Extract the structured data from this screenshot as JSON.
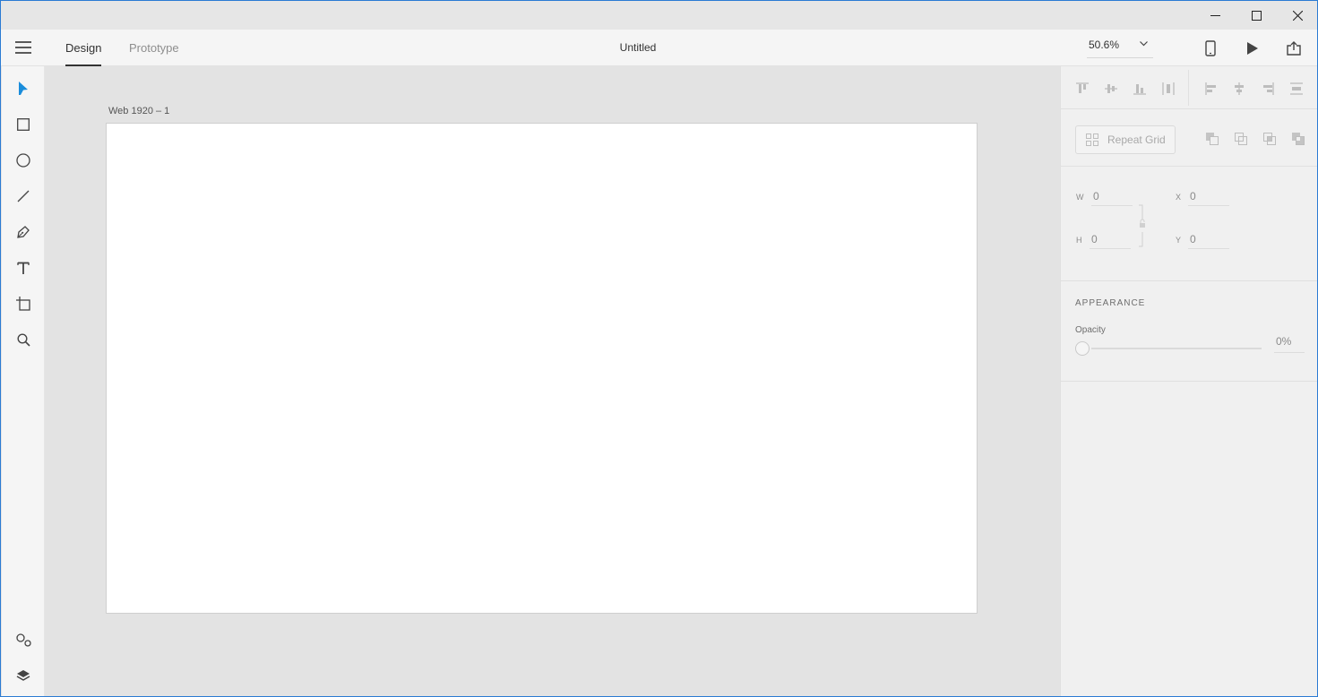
{
  "app": {
    "document_title": "Untitled",
    "tabs": [
      {
        "label": "Design",
        "active": true
      },
      {
        "label": "Prototype",
        "active": false
      }
    ],
    "zoom": "50.6%"
  },
  "window_controls": [
    "minimize-icon",
    "maximize-icon",
    "close-icon"
  ],
  "toolbar": {
    "tools": [
      "select-icon",
      "rectangle-icon",
      "ellipse-icon",
      "line-icon",
      "pen-icon",
      "text-icon",
      "artboard-icon",
      "zoom-icon"
    ],
    "bottom": [
      "assets-icon",
      "layers-icon"
    ],
    "active_tool": "select-icon",
    "accent_color": "#1a8ddb"
  },
  "canvas": {
    "artboard_label": "Web 1920 – 1"
  },
  "inspector": {
    "repeat_grid_label": "Repeat Grid",
    "w_label": "W",
    "w_value": "0",
    "h_label": "H",
    "h_value": "0",
    "x_label": "X",
    "x_value": "0",
    "y_label": "Y",
    "y_value": "0",
    "appearance_title": "APPEARANCE",
    "opacity_label": "Opacity",
    "opacity_value": "0%"
  }
}
